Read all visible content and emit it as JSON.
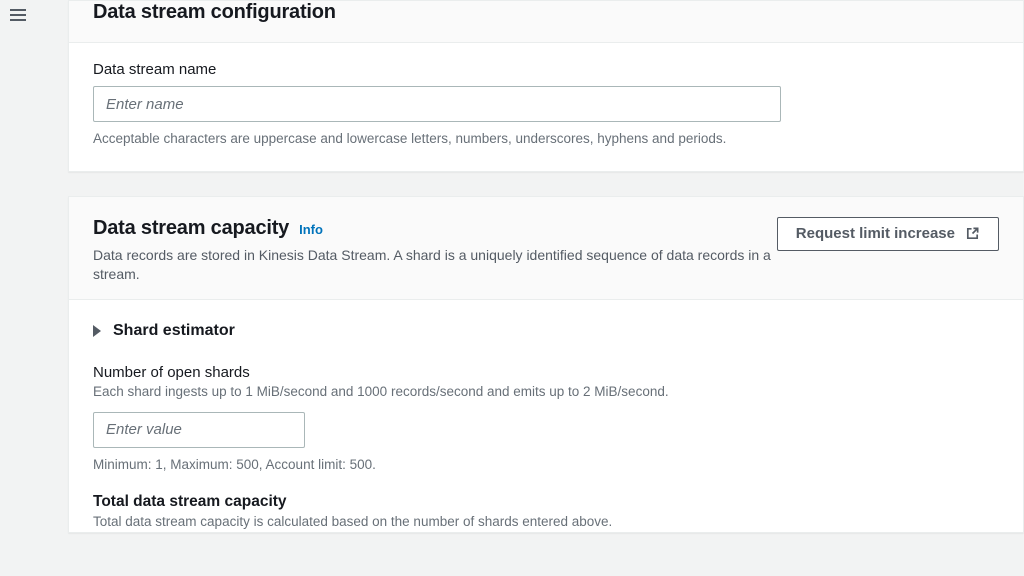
{
  "config_panel": {
    "title": "Data stream configuration",
    "name_label": "Data stream name",
    "name_placeholder": "Enter name",
    "name_helper": "Acceptable characters are uppercase and lowercase letters, numbers, underscores, hyphens and periods."
  },
  "capacity_panel": {
    "title": "Data stream capacity",
    "info_label": "Info",
    "description": "Data records are stored in Kinesis Data Stream. A shard is a uniquely identified sequence of data records in a stream.",
    "request_button": "Request limit increase",
    "estimator_label": "Shard estimator",
    "shards_label": "Number of open shards",
    "shards_helper": "Each shard ingests up to 1 MiB/second and 1000 records/second and emits up to 2 MiB/second.",
    "shards_placeholder": "Enter value",
    "shards_limits": "Minimum: 1, Maximum: 500, Account limit: 500.",
    "total_title": "Total data stream capacity",
    "total_desc": "Total data stream capacity is calculated based on the number of shards entered above."
  }
}
